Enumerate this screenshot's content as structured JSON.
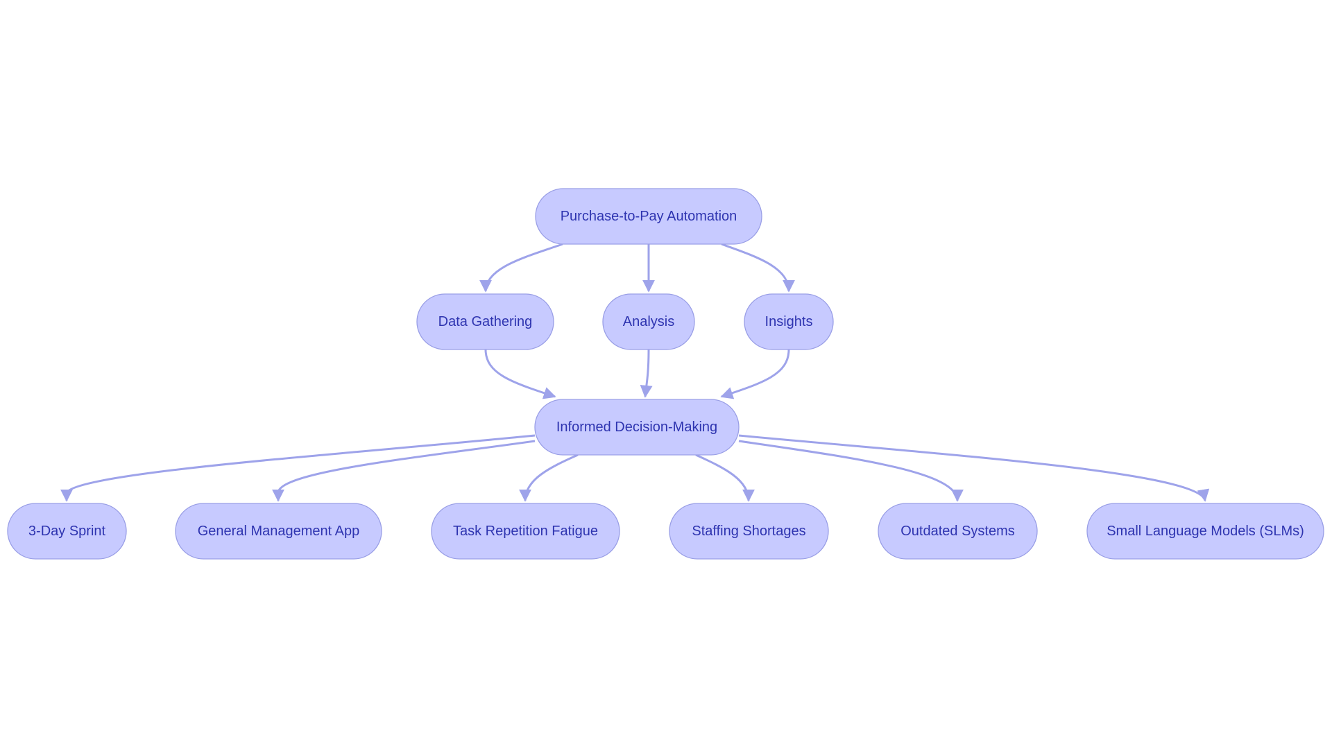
{
  "diagram": {
    "type": "flowchart",
    "colors": {
      "node_fill": "#c7caff",
      "node_stroke": "#9a9fe6",
      "text": "#2e34b0",
      "edge": "#9ea3ea",
      "background": "#ffffff"
    },
    "nodes": [
      {
        "id": "p2p",
        "label": "Purchase-to-Pay Automation"
      },
      {
        "id": "data",
        "label": "Data Gathering"
      },
      {
        "id": "analysis",
        "label": "Analysis"
      },
      {
        "id": "insights",
        "label": "Insights"
      },
      {
        "id": "idm",
        "label": "Informed Decision-Making"
      },
      {
        "id": "sprint",
        "label": "3-Day Sprint"
      },
      {
        "id": "gma",
        "label": "General Management App"
      },
      {
        "id": "trf",
        "label": "Task Repetition Fatigue"
      },
      {
        "id": "staff",
        "label": "Staffing Shortages"
      },
      {
        "id": "outdated",
        "label": "Outdated Systems"
      },
      {
        "id": "slm",
        "label": "Small Language Models (SLMs)"
      }
    ],
    "edges": [
      {
        "from": "p2p",
        "to": "data"
      },
      {
        "from": "p2p",
        "to": "analysis"
      },
      {
        "from": "p2p",
        "to": "insights"
      },
      {
        "from": "data",
        "to": "idm"
      },
      {
        "from": "analysis",
        "to": "idm"
      },
      {
        "from": "insights",
        "to": "idm"
      },
      {
        "from": "idm",
        "to": "sprint"
      },
      {
        "from": "idm",
        "to": "gma"
      },
      {
        "from": "idm",
        "to": "trf"
      },
      {
        "from": "idm",
        "to": "staff"
      },
      {
        "from": "idm",
        "to": "outdated"
      },
      {
        "from": "idm",
        "to": "slm"
      }
    ]
  }
}
